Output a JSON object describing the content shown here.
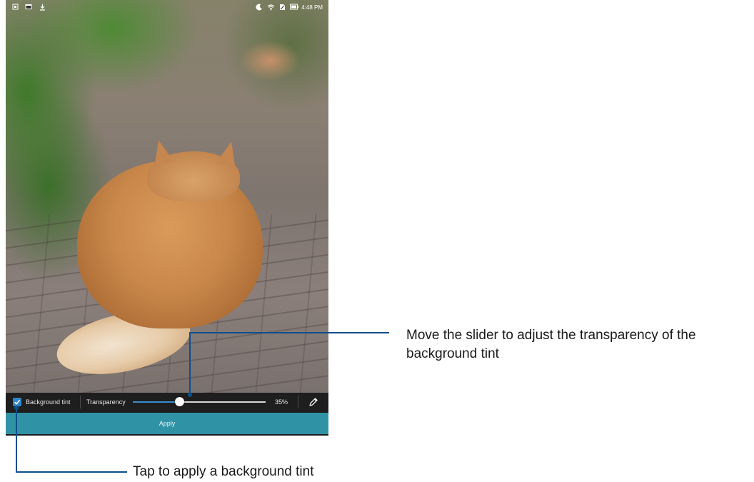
{
  "status_bar": {
    "left_icons": [
      "screenshot-icon",
      "gallery-icon",
      "download-icon"
    ],
    "right_icons": [
      "moon-icon",
      "wifi-icon",
      "no-sim-icon",
      "battery-icon"
    ],
    "time": "4:48 PM"
  },
  "photo": {
    "subject": "cat-photo"
  },
  "toolbar": {
    "background_tint_label": "Background tint",
    "background_tint_checked": true,
    "transparency_label": "Transparency",
    "transparency_value": 0.35,
    "transparency_percent": "35%",
    "edit_icon": "pen-icon"
  },
  "apply_button": {
    "label": "Apply"
  },
  "callouts": {
    "slider": "Move the slider to adjust the transparency of the background tint",
    "tint": "Tap to apply a background tint"
  },
  "colors": {
    "accent": "#3a8fd0",
    "apply_bar": "#2f93a5",
    "callout_line": "#0d4f8b",
    "toolbar": "#1e1e1e"
  }
}
